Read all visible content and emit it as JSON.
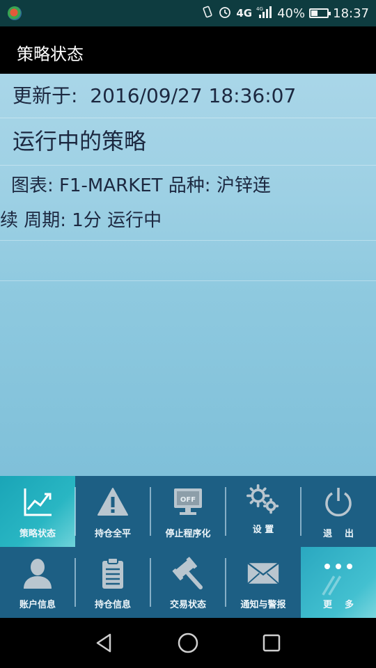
{
  "status_bar": {
    "network": "4G",
    "battery": "40%",
    "battery_level": 0.4,
    "time": "18:37"
  },
  "header": {
    "title": "策略状态"
  },
  "main": {
    "updated_label": "更新于:",
    "updated_value": "2016/09/27 18:36:07",
    "section_title": "运行中的策略",
    "strategy_line1": "图表: F1-MARKET 品种: 沪锌连",
    "strategy_line2": "续 周期: 1分 运行中"
  },
  "menu": {
    "items": [
      {
        "label": "策略状态",
        "icon": "trend-chart-icon"
      },
      {
        "label": "持仓全平",
        "icon": "warning-icon"
      },
      {
        "label": "停止程序化",
        "icon": "off-monitor-icon"
      },
      {
        "label": "设 置",
        "icon": "gears-icon"
      },
      {
        "label": "退    出",
        "icon": "power-icon"
      },
      {
        "label": "账户信息",
        "icon": "user-icon"
      },
      {
        "label": "持仓信息",
        "icon": "clipboard-icon"
      },
      {
        "label": "交易状态",
        "icon": "gavel-icon"
      },
      {
        "label": "通知与警报",
        "icon": "mail-icon"
      },
      {
        "label": "更    多",
        "icon": "more-dots-icon"
      }
    ],
    "monitor_text": "OFF"
  },
  "colors": {
    "status_bar": "#0e3c40",
    "menu_bg": "#1d5f84",
    "active_tile": "#29b6c3",
    "main_bg": "#9dd0e4"
  }
}
